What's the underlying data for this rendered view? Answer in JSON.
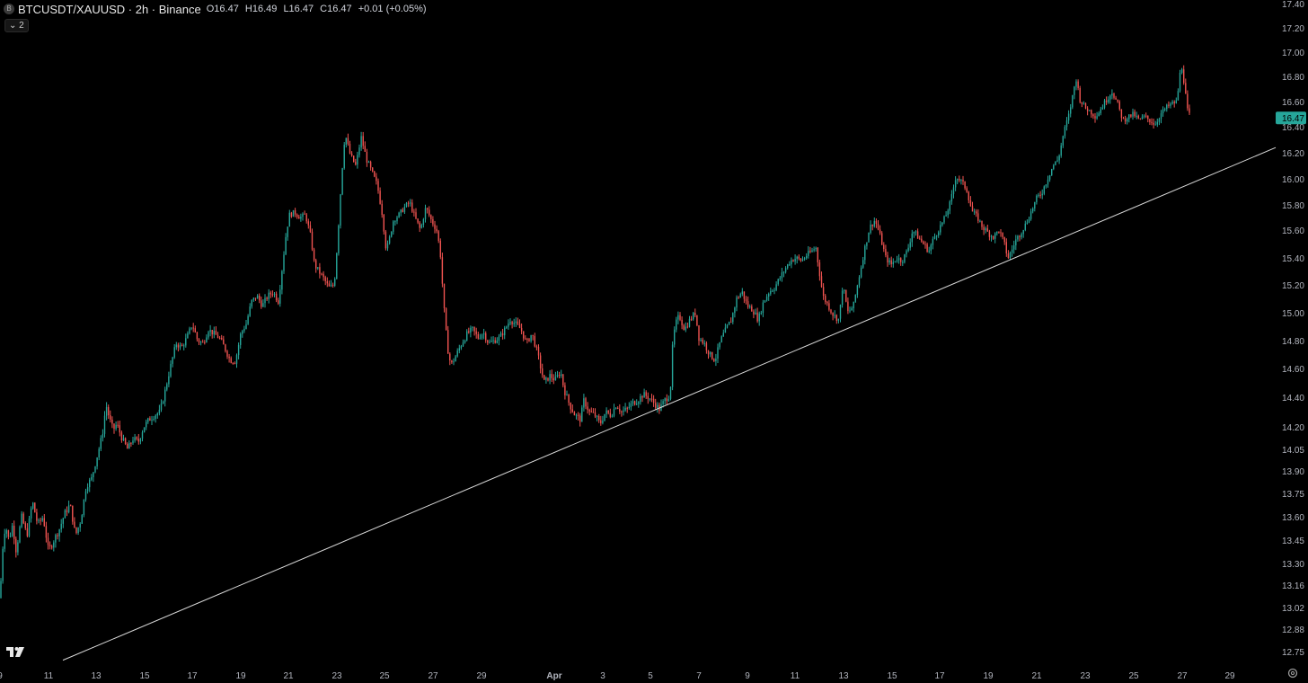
{
  "header": {
    "symbol_label": "BTCUSDT/XAUUSD · 2h · Binance",
    "symbol_icon": "bitcoin-circle-icon",
    "open": "O16.47",
    "high": "H16.49",
    "low": "L16.47",
    "close": "C16.47",
    "change": "+0.01 (+0.05%)"
  },
  "indicators_toggle": "⌄ 2",
  "price_tag": "16.47",
  "colors": {
    "background": "#000000",
    "up": "#26a69a",
    "down": "#ef5350",
    "trendline": "#d9d9d9",
    "price_tag_bg": "#26a69a",
    "axis_text": "#b2b5be"
  },
  "chart_data": {
    "type": "candlestick",
    "x_ticks": [
      "9",
      "11",
      "13",
      "15",
      "17",
      "19",
      "21",
      "23",
      "25",
      "27",
      "29",
      "Apr",
      "3",
      "5",
      "7",
      "9",
      "11",
      "13",
      "15",
      "17",
      "19",
      "21",
      "23",
      "25",
      "27",
      "29"
    ],
    "y_ticks": [
      "17.40",
      "17.20",
      "17.00",
      "16.80",
      "16.60",
      "16.40",
      "16.20",
      "16.00",
      "15.80",
      "15.60",
      "15.40",
      "15.20",
      "15.00",
      "14.80",
      "14.60",
      "14.40",
      "14.20",
      "14.05",
      "13.90",
      "13.75",
      "13.60",
      "13.45",
      "13.30",
      "13.16",
      "13.02",
      "12.88",
      "12.75"
    ],
    "ylim": [
      12.72,
      17.42
    ],
    "last_price": 16.47,
    "path": [
      [
        0,
        13.08
      ],
      [
        3,
        13.4
      ],
      [
        6,
        13.55
      ],
      [
        10,
        13.45
      ],
      [
        14,
        13.55
      ],
      [
        18,
        13.38
      ],
      [
        24,
        13.6
      ],
      [
        30,
        13.48
      ],
      [
        36,
        13.7
      ],
      [
        42,
        13.55
      ],
      [
        48,
        13.6
      ],
      [
        54,
        13.38
      ],
      [
        60,
        13.45
      ],
      [
        66,
        13.52
      ],
      [
        72,
        13.62
      ],
      [
        78,
        13.68
      ],
      [
        84,
        13.48
      ],
      [
        90,
        13.58
      ],
      [
        96,
        13.8
      ],
      [
        102,
        13.85
      ],
      [
        108,
        14.0
      ],
      [
        114,
        14.15
      ],
      [
        118,
        14.35
      ],
      [
        122,
        14.25
      ],
      [
        126,
        14.18
      ],
      [
        130,
        14.22
      ],
      [
        136,
        14.12
      ],
      [
        142,
        14.05
      ],
      [
        148,
        14.12
      ],
      [
        154,
        14.1
      ],
      [
        160,
        14.2
      ],
      [
        166,
        14.25
      ],
      [
        172,
        14.28
      ],
      [
        178,
        14.3
      ],
      [
        184,
        14.45
      ],
      [
        190,
        14.62
      ],
      [
        196,
        14.78
      ],
      [
        202,
        14.75
      ],
      [
        208,
        14.82
      ],
      [
        214,
        14.92
      ],
      [
        220,
        14.8
      ],
      [
        226,
        14.78
      ],
      [
        232,
        14.88
      ],
      [
        238,
        14.85
      ],
      [
        244,
        14.82
      ],
      [
        250,
        14.75
      ],
      [
        256,
        14.66
      ],
      [
        262,
        14.65
      ],
      [
        268,
        14.85
      ],
      [
        274,
        14.92
      ],
      [
        280,
        15.08
      ],
      [
        286,
        15.12
      ],
      [
        292,
        15.05
      ],
      [
        298,
        15.12
      ],
      [
        304,
        15.15
      ],
      [
        310,
        15.08
      ],
      [
        314,
        15.32
      ],
      [
        318,
        15.55
      ],
      [
        322,
        15.72
      ],
      [
        328,
        15.74
      ],
      [
        334,
        15.7
      ],
      [
        340,
        15.72
      ],
      [
        346,
        15.55
      ],
      [
        350,
        15.35
      ],
      [
        355,
        15.3
      ],
      [
        360,
        15.25
      ],
      [
        366,
        15.18
      ],
      [
        372,
        15.2
      ],
      [
        376,
        15.55
      ],
      [
        380,
        16.0
      ],
      [
        384,
        16.35
      ],
      [
        390,
        16.18
      ],
      [
        396,
        16.1
      ],
      [
        402,
        16.32
      ],
      [
        408,
        16.15
      ],
      [
        414,
        16.05
      ],
      [
        420,
        15.95
      ],
      [
        425,
        15.75
      ],
      [
        430,
        15.45
      ],
      [
        434,
        15.55
      ],
      [
        438,
        15.68
      ],
      [
        444,
        15.72
      ],
      [
        450,
        15.78
      ],
      [
        456,
        15.82
      ],
      [
        462,
        15.7
      ],
      [
        468,
        15.6
      ],
      [
        474,
        15.78
      ],
      [
        480,
        15.68
      ],
      [
        486,
        15.6
      ],
      [
        490,
        15.45
      ],
      [
        494,
        15.05
      ],
      [
        498,
        14.75
      ],
      [
        502,
        14.62
      ],
      [
        508,
        14.7
      ],
      [
        514,
        14.78
      ],
      [
        520,
        14.85
      ],
      [
        526,
        14.88
      ],
      [
        532,
        14.82
      ],
      [
        538,
        14.86
      ],
      [
        544,
        14.78
      ],
      [
        550,
        14.8
      ],
      [
        556,
        14.82
      ],
      [
        562,
        14.88
      ],
      [
        568,
        14.95
      ],
      [
        574,
        14.92
      ],
      [
        580,
        14.88
      ],
      [
        586,
        14.78
      ],
      [
        592,
        14.85
      ],
      [
        598,
        14.72
      ],
      [
        602,
        14.6
      ],
      [
        606,
        14.5
      ],
      [
        612,
        14.55
      ],
      [
        618,
        14.52
      ],
      [
        624,
        14.58
      ],
      [
        628,
        14.45
      ],
      [
        634,
        14.35
      ],
      [
        640,
        14.28
      ],
      [
        646,
        14.25
      ],
      [
        650,
        14.38
      ],
      [
        656,
        14.3
      ],
      [
        662,
        14.28
      ],
      [
        668,
        14.22
      ],
      [
        674,
        14.3
      ],
      [
        680,
        14.28
      ],
      [
        686,
        14.35
      ],
      [
        692,
        14.3
      ],
      [
        698,
        14.32
      ],
      [
        704,
        14.36
      ],
      [
        710,
        14.38
      ],
      [
        716,
        14.42
      ],
      [
        722,
        14.4
      ],
      [
        728,
        14.36
      ],
      [
        734,
        14.32
      ],
      [
        740,
        14.38
      ],
      [
        746,
        14.42
      ],
      [
        749,
        14.8
      ],
      [
        752,
        14.92
      ],
      [
        756,
        14.98
      ],
      [
        762,
        14.88
      ],
      [
        768,
        14.95
      ],
      [
        774,
        15.0
      ],
      [
        778,
        14.82
      ],
      [
        784,
        14.78
      ],
      [
        790,
        14.7
      ],
      [
        796,
        14.66
      ],
      [
        802,
        14.8
      ],
      [
        808,
        14.88
      ],
      [
        814,
        14.95
      ],
      [
        820,
        15.1
      ],
      [
        826,
        15.15
      ],
      [
        832,
        15.05
      ],
      [
        838,
        15.02
      ],
      [
        844,
        14.95
      ],
      [
        850,
        15.08
      ],
      [
        856,
        15.15
      ],
      [
        862,
        15.18
      ],
      [
        868,
        15.25
      ],
      [
        874,
        15.32
      ],
      [
        880,
        15.38
      ],
      [
        886,
        15.4
      ],
      [
        892,
        15.38
      ],
      [
        898,
        15.42
      ],
      [
        904,
        15.45
      ],
      [
        908,
        15.48
      ],
      [
        912,
        15.3
      ],
      [
        916,
        15.12
      ],
      [
        922,
        15.05
      ],
      [
        928,
        14.98
      ],
      [
        934,
        14.95
      ],
      [
        938,
        15.2
      ],
      [
        944,
        15.0
      ],
      [
        950,
        15.05
      ],
      [
        956,
        15.25
      ],
      [
        962,
        15.45
      ],
      [
        968,
        15.62
      ],
      [
        974,
        15.68
      ],
      [
        980,
        15.55
      ],
      [
        986,
        15.4
      ],
      [
        992,
        15.35
      ],
      [
        998,
        15.4
      ],
      [
        1004,
        15.38
      ],
      [
        1010,
        15.45
      ],
      [
        1016,
        15.6
      ],
      [
        1022,
        15.55
      ],
      [
        1028,
        15.5
      ],
      [
        1034,
        15.45
      ],
      [
        1040,
        15.55
      ],
      [
        1046,
        15.62
      ],
      [
        1052,
        15.7
      ],
      [
        1058,
        15.82
      ],
      [
        1064,
        16.02
      ],
      [
        1070,
        15.98
      ],
      [
        1076,
        15.92
      ],
      [
        1082,
        15.75
      ],
      [
        1088,
        15.7
      ],
      [
        1094,
        15.62
      ],
      [
        1100,
        15.58
      ],
      [
        1106,
        15.55
      ],
      [
        1112,
        15.6
      ],
      [
        1118,
        15.5
      ],
      [
        1122,
        15.4
      ],
      [
        1126,
        15.45
      ],
      [
        1130,
        15.52
      ],
      [
        1136,
        15.58
      ],
      [
        1142,
        15.65
      ],
      [
        1148,
        15.75
      ],
      [
        1154,
        15.85
      ],
      [
        1160,
        15.9
      ],
      [
        1166,
        16.0
      ],
      [
        1172,
        16.1
      ],
      [
        1178,
        16.15
      ],
      [
        1184,
        16.35
      ],
      [
        1190,
        16.5
      ],
      [
        1196,
        16.72
      ],
      [
        1198,
        16.78
      ],
      [
        1202,
        16.62
      ],
      [
        1208,
        16.55
      ],
      [
        1214,
        16.52
      ],
      [
        1220,
        16.48
      ],
      [
        1226,
        16.55
      ],
      [
        1232,
        16.62
      ],
      [
        1238,
        16.68
      ],
      [
        1244,
        16.58
      ],
      [
        1250,
        16.45
      ],
      [
        1256,
        16.48
      ],
      [
        1262,
        16.5
      ],
      [
        1268,
        16.45
      ],
      [
        1274,
        16.48
      ],
      [
        1280,
        16.45
      ],
      [
        1286,
        16.42
      ],
      [
        1292,
        16.5
      ],
      [
        1298,
        16.55
      ],
      [
        1304,
        16.58
      ],
      [
        1310,
        16.6
      ],
      [
        1314,
        16.85
      ],
      [
        1316,
        16.88
      ],
      [
        1318,
        16.75
      ],
      [
        1322,
        16.52
      ],
      [
        1326,
        16.47
      ]
    ],
    "trendline": {
      "from": [
        12.7,
        70
      ],
      "to": [
        16.24,
        1420
      ],
      "note": "support trendline"
    }
  }
}
